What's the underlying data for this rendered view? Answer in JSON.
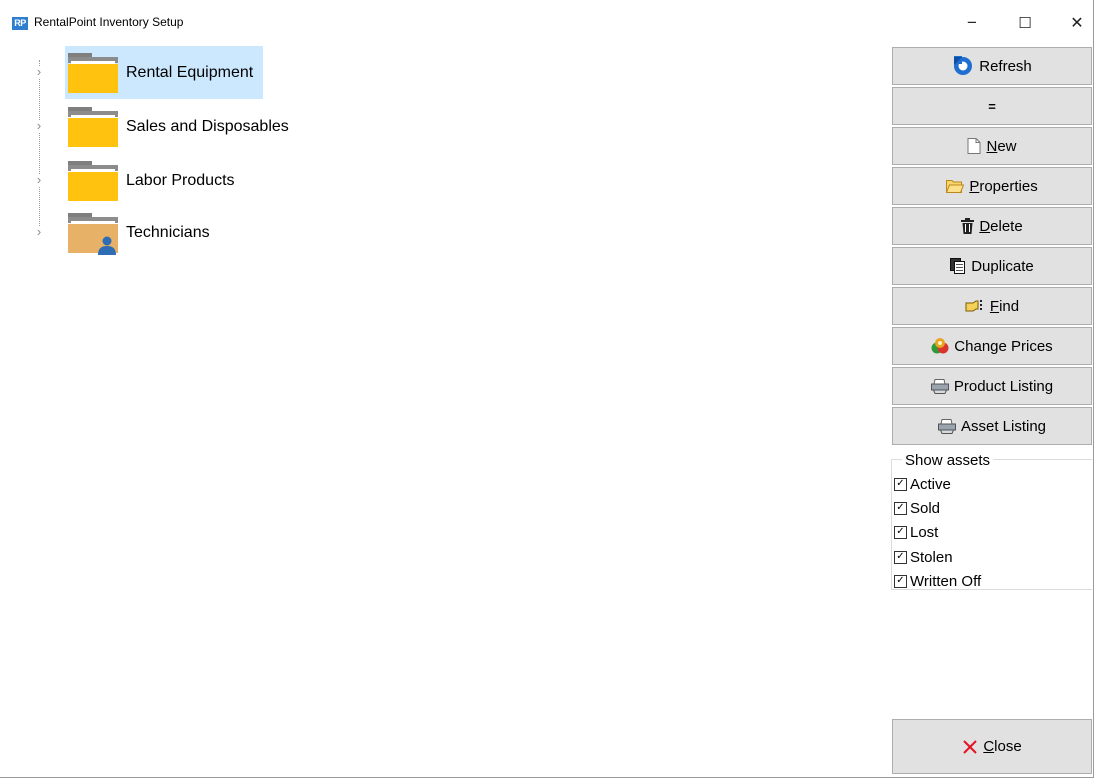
{
  "window": {
    "title": "RentalPoint Inventory Setup",
    "app_icon_text": "RP",
    "minimize": "−",
    "maximize": "☐",
    "close": "✕"
  },
  "tree": {
    "expander_glyph": "›",
    "items": [
      {
        "label": "Rental Equipment",
        "icon": "folder-icon",
        "selected": true
      },
      {
        "label": "Sales and Disposables",
        "icon": "folder-icon",
        "selected": false
      },
      {
        "label": "Labor Products",
        "icon": "folder-icon",
        "selected": false
      },
      {
        "label": "Technicians",
        "icon": "user-folder-icon",
        "selected": false
      }
    ]
  },
  "buttons": {
    "refresh": "Refresh",
    "collapse": "=",
    "new_first": "N",
    "new_rest": "ew",
    "properties_first": "P",
    "properties_rest": "roperties",
    "delete_first": "D",
    "delete_rest": "elete",
    "duplicate": "Duplicate",
    "find_first": "F",
    "find_rest": "ind",
    "change_prices": "Change Prices",
    "product_listing": "Product Listing",
    "asset_listing": "Asset Listing",
    "close_first": "C",
    "close_rest": "lose"
  },
  "show_assets": {
    "legend": "Show assets",
    "check_glyph": "✓",
    "options": [
      {
        "label": "Active",
        "checked": true
      },
      {
        "label": "Sold",
        "checked": true
      },
      {
        "label": "Lost",
        "checked": true
      },
      {
        "label": "Stolen",
        "checked": true
      },
      {
        "label": "Written Off",
        "checked": true
      }
    ]
  },
  "colors": {
    "selection": "#cce8ff",
    "folder": "#ffc20e",
    "user_folder": "#e8b168",
    "button_face": "#e1e1e1",
    "close_x": "#e81123",
    "refresh_blue": "#1f6fd1"
  }
}
